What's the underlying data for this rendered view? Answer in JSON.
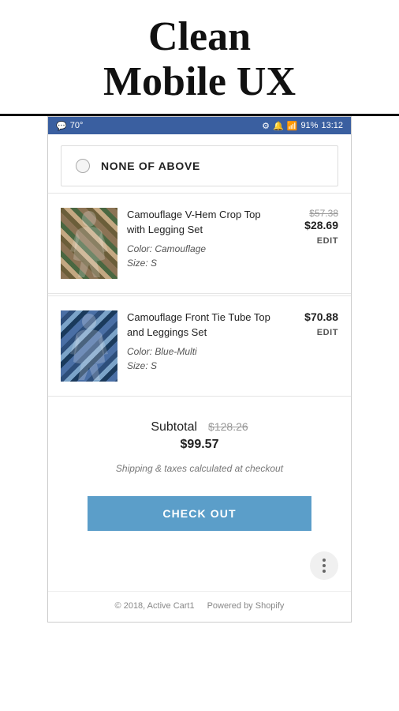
{
  "header": {
    "line1": "Clean",
    "line2": "Mobile UX"
  },
  "statusBar": {
    "left": "70°",
    "battery": "91%",
    "time": "13:12"
  },
  "noneOption": {
    "label": "NONE OF ABOVE"
  },
  "cartItems": [
    {
      "id": "item-1",
      "name": "Camouflage V-Hem Crop Top with Legging Set",
      "color": "Color: Camouflage",
      "size": "Size: S",
      "priceOriginal": "$57.38",
      "priceSale": "$28.69",
      "editLabel": "EDIT",
      "camoClass": "camo-1"
    },
    {
      "id": "item-2",
      "name": "Camouflage Front Tie Tube Top and Leggings Set",
      "color": "Color: Blue-Multi",
      "size": "Size: S",
      "priceOriginal": null,
      "priceSale": "$70.88",
      "editLabel": "EDIT",
      "camoClass": "camo-2"
    }
  ],
  "subtotal": {
    "label": "Subtotal",
    "originalPrice": "$128.26",
    "salePrice": "$99.57"
  },
  "shipping": {
    "note": "Shipping & taxes calculated at checkout"
  },
  "checkout": {
    "buttonLabel": "CHECK OUT"
  },
  "footer": {
    "copyright": "© 2018, Active Cart1",
    "powered": "Powered by Shopify"
  }
}
